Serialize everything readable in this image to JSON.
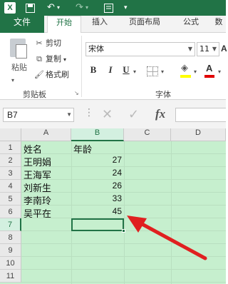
{
  "window": {
    "app_icon": "excel-icon"
  },
  "quick_access": {
    "save": "save-icon",
    "undo": "undo-icon",
    "redo": "redo-icon",
    "customize": "customize-icon"
  },
  "ribbon_tabs": {
    "file": "文件",
    "home": "开始",
    "insert": "插入",
    "page_layout": "页面布局",
    "formulas": "公式",
    "data": "数"
  },
  "clipboard": {
    "paste": "粘贴",
    "cut": "剪切",
    "copy": "复制",
    "format_painter": "格式刷",
    "group_label": "剪贴板"
  },
  "font": {
    "name": "宋体",
    "size": "11",
    "bold": "B",
    "italic": "I",
    "underline": "U",
    "group_label": "字体",
    "fill_color": "#ffff00",
    "font_color": "#e00000"
  },
  "formula_bar": {
    "name_box": "B7",
    "fx": "fx",
    "value": ""
  },
  "sheet": {
    "columns": [
      "A",
      "B",
      "C",
      "D"
    ],
    "rows": [
      "1",
      "2",
      "3",
      "4",
      "5",
      "6",
      "7",
      "8",
      "9",
      "10",
      "11"
    ],
    "cells": {
      "A1": "姓名",
      "B1": "年龄",
      "A2": "王明娟",
      "B2": "27",
      "A3": "王海军",
      "B3": "24",
      "A4": "刘新生",
      "B4": "26",
      "A5": "李南玲",
      "B5": "33",
      "A6": "吴平在",
      "B6": "45"
    },
    "selected_cell": "B7",
    "background": "#c6efce",
    "accent": "#217346",
    "annotation_arrow_color": "#e02020"
  }
}
